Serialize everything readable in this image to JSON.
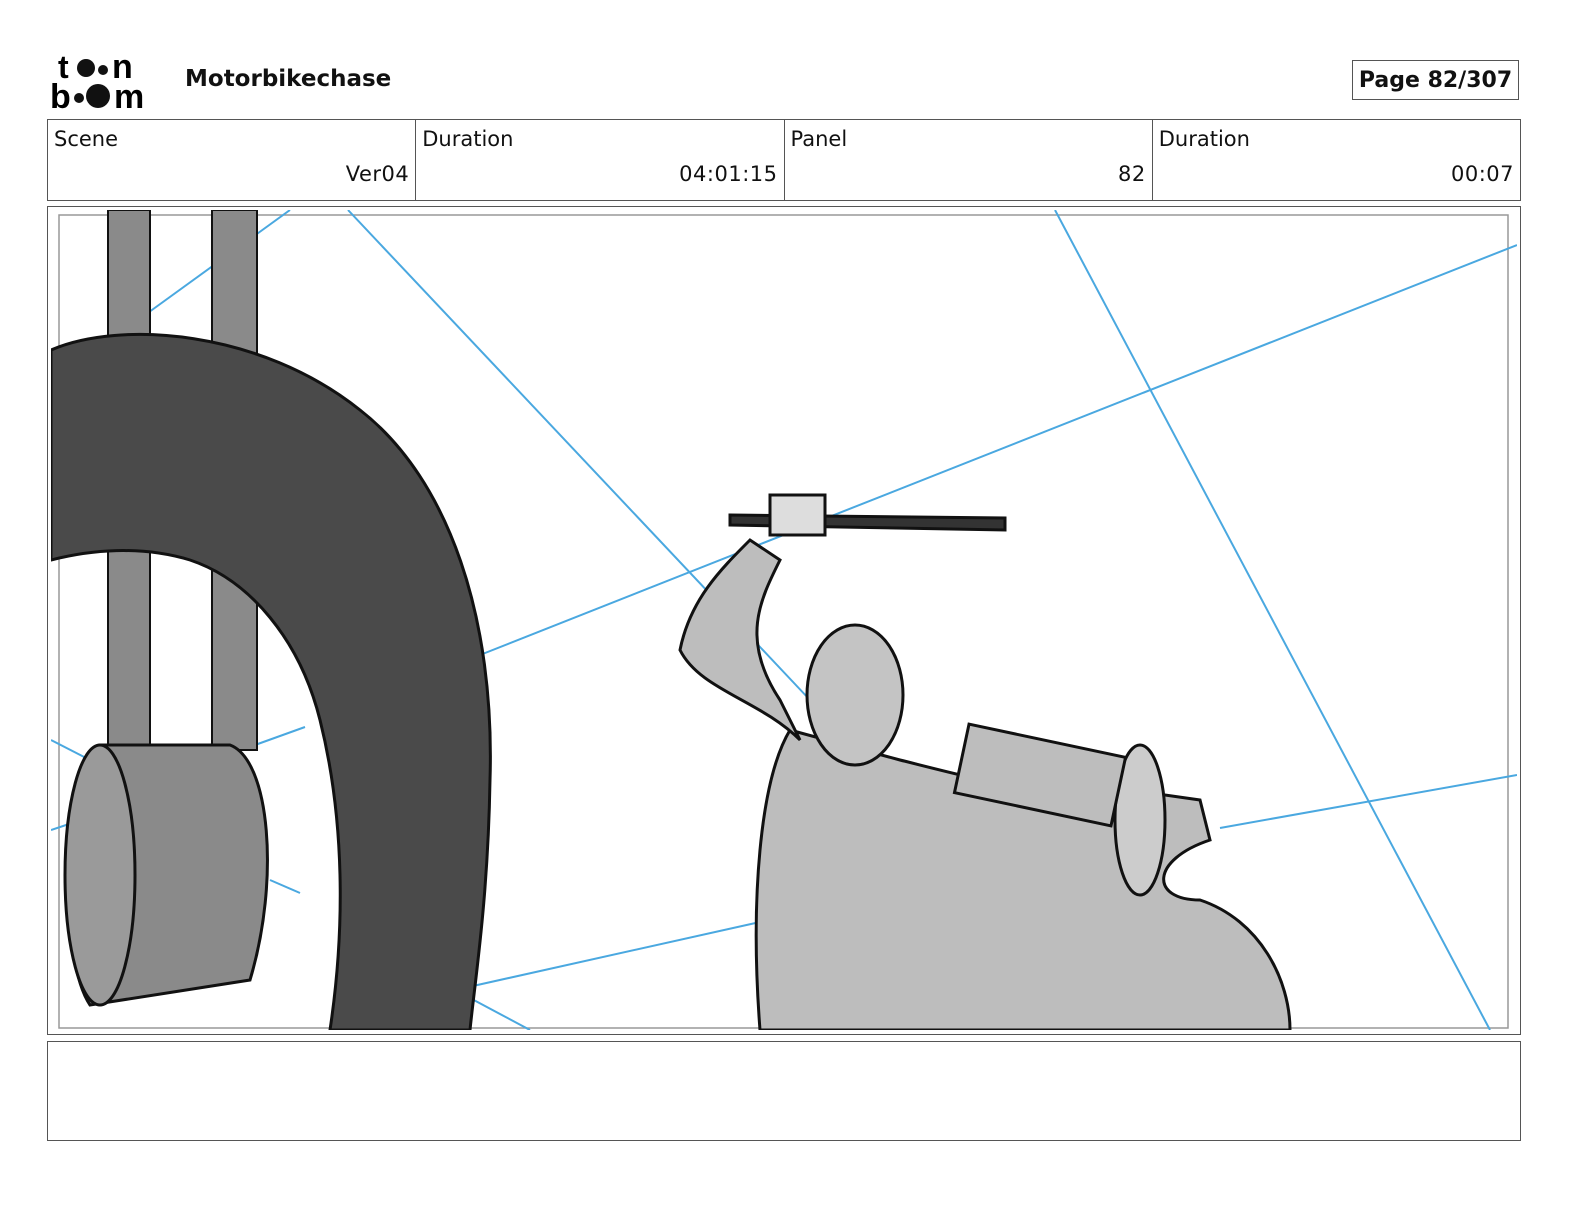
{
  "header": {
    "logo_text": "toon boom",
    "project_title": "Motorbikechase",
    "page_label": "Page  82/307"
  },
  "info": [
    {
      "label": "Scene",
      "value": "Ver04"
    },
    {
      "label": "Duration",
      "value": "04:01:15"
    },
    {
      "label": "Panel",
      "value": "82"
    },
    {
      "label": "Duration",
      "value": "00:07"
    }
  ],
  "colors": {
    "perspective_lines": "#4aa8e0",
    "tire": "#4a4a4a",
    "figure": "#bdbdbd"
  },
  "caption": ""
}
